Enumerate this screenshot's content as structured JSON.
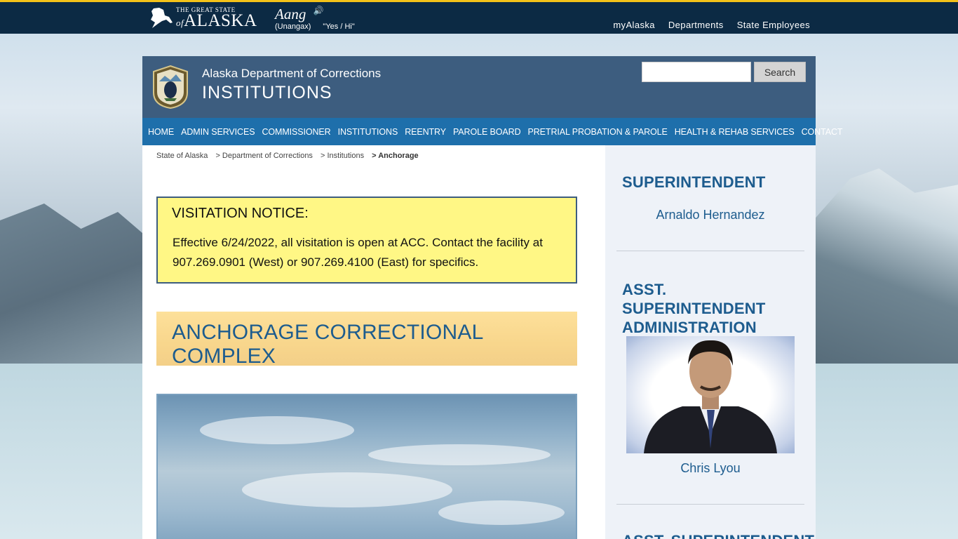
{
  "topbar": {
    "logo_small": "THE GREAT STATE",
    "logo_of": "of",
    "logo_big": "ALASKA",
    "aang_word": "Aang",
    "aang_sub_lang": "(Unangax)",
    "aang_sub_meaning": "\"Yes / Hi\"",
    "links": [
      "myAlaska",
      "Departments",
      "State Employees"
    ]
  },
  "header": {
    "department": "Alaska Department of Corrections",
    "section": "INSTITUTIONS",
    "search_placeholder": "",
    "search_button": "Search"
  },
  "nav": [
    "HOME",
    "ADMIN SERVICES",
    "COMMISSIONER",
    "INSTITUTIONS",
    "REENTRY",
    "PAROLE BOARD",
    "PRETRIAL PROBATION & PAROLE",
    "HEALTH & REHAB SERVICES",
    "CONTACT"
  ],
  "breadcrumb": [
    "State of Alaska",
    "> Department of Corrections",
    "> Institutions",
    "> Anchorage"
  ],
  "notice": {
    "title": "VISITATION NOTICE:",
    "body": "Effective 6/24/2022, all visitation is open at ACC. Contact the facility at 907.269.0901 (West) or 907.269.4100 (East) for specifics."
  },
  "banner": {
    "title": "ANCHORAGE CORRECTIONAL COMPLEX"
  },
  "sidebar": {
    "sections": [
      {
        "heading": "SUPERINTENDENT",
        "name": "Arnaldo Hernandez"
      },
      {
        "heading": "ASST. SUPERINTENDENT ADMINISTRATION",
        "name": "Chris Lyou"
      },
      {
        "heading": "ASST. SUPERINTENDENT"
      }
    ]
  },
  "colors": {
    "topbar": "#0c2a44",
    "accent": "#f4c218",
    "header": "#3d5d7f",
    "nav": "#1e6fab",
    "notice_bg": "#fff785",
    "heading_blue": "#1d5c8e"
  }
}
